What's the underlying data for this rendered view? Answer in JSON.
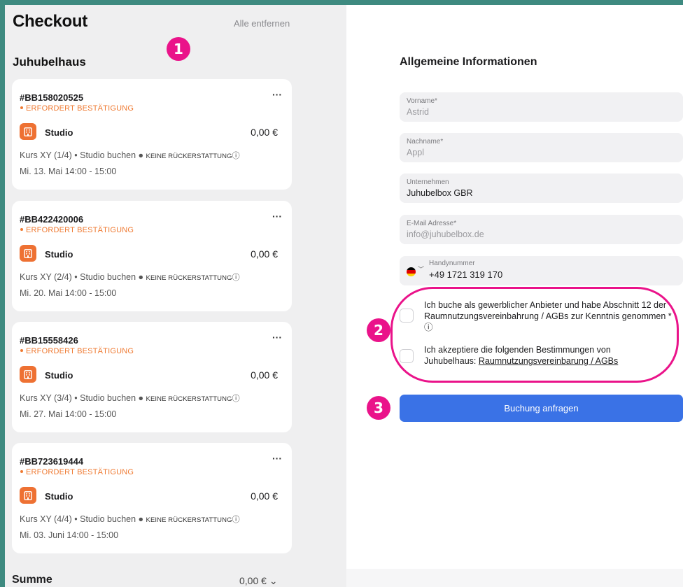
{
  "checkout": {
    "title": "Checkout",
    "remove_all": "Alle entfernen",
    "vendor": "Juhubelhaus",
    "sum_label": "Summe",
    "sum_value": "0,00 € ⌄",
    "bookings": [
      {
        "number": "#BB158020525",
        "status": "ERFORDERT BESTÄTIGUNG",
        "room": "Studio",
        "price": "0,00 €",
        "course": "Kurs XY (1/4) • Studio buchen ● ",
        "refund": "KEINE RÜCKERSTATTUNG",
        "info": "ⓘ",
        "time": "Mi. 13. Mai  14:00 - 15:00",
        "more": "···"
      },
      {
        "number": "#BB422420006",
        "status": "ERFORDERT BESTÄTIGUNG",
        "room": "Studio",
        "price": "0,00 €",
        "course": "Kurs XY (2/4) • Studio buchen ● ",
        "refund": "KEINE RÜCKERSTATTUNG",
        "info": "ⓘ",
        "time": "Mi. 20. Mai  14:00 - 15:00",
        "more": "···"
      },
      {
        "number": "#BB15558426",
        "status": "ERFORDERT BESTÄTIGUNG",
        "room": "Studio",
        "price": "0,00 €",
        "course": "Kurs XY (3/4) • Studio buchen ● ",
        "refund": "KEINE RÜCKERSTATTUNG",
        "info": "ⓘ",
        "time": "Mi. 27. Mai  14:00 - 15:00",
        "more": "···"
      },
      {
        "number": "#BB723619444",
        "status": "ERFORDERT BESTÄTIGUNG",
        "room": "Studio",
        "price": "0,00 €",
        "course": "Kurs XY (4/4) • Studio buchen ● ",
        "refund": "KEINE RÜCKERSTATTUNG",
        "info": "ⓘ",
        "time": "Mi. 03. Juni  14:00 - 15:00",
        "more": "···"
      }
    ]
  },
  "form": {
    "title": "Allgemeine Informationen",
    "firstname": {
      "label": "Vorname*",
      "value": "Astrid"
    },
    "lastname": {
      "label": "Nachname*",
      "value": "Appl"
    },
    "company": {
      "label": "Unternehmen",
      "value": "Juhubelbox GBR"
    },
    "email": {
      "label": "E-Mail Adresse*",
      "value": "info@juhubelbox.de"
    },
    "phone": {
      "label": "Handynummer",
      "value": "+49 1721 319 170"
    },
    "consent1": "Ich buche als gewerblicher Anbieter und habe Abschnitt 12 der Raumnutzungsvereinbahrung / AGBs zur Kenntnis genommen * ⓘ",
    "consent2_prefix": "Ich akzeptiere die folgenden Bestimmungen von Juhubelhaus: ",
    "consent2_link": "Raumnutzungsvereinbarung / AGBs",
    "submit": "Buchung anfragen"
  },
  "annotations": {
    "one": "1",
    "two": "2",
    "three": "3"
  },
  "colors": {
    "accent": "#3a72e6",
    "status": "#ef7a32",
    "annotation": "#ea138a",
    "frame": "#3e8a80"
  },
  "icons": {
    "room": "building-icon",
    "more": "more-dots-icon",
    "flag": "germany-flag-icon"
  }
}
